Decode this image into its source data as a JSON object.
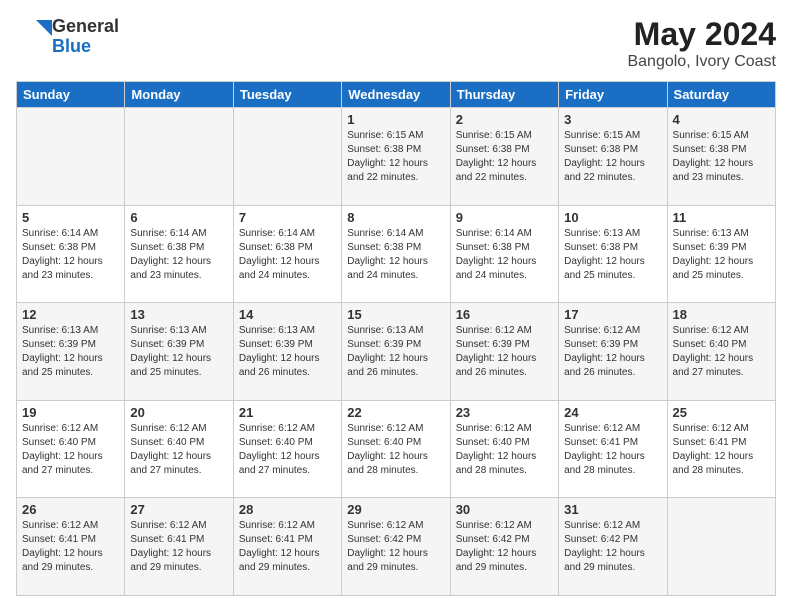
{
  "logo": {
    "line1": "General",
    "line2": "Blue"
  },
  "header": {
    "month_year": "May 2024",
    "location": "Bangolo, Ivory Coast"
  },
  "weekdays": [
    "Sunday",
    "Monday",
    "Tuesday",
    "Wednesday",
    "Thursday",
    "Friday",
    "Saturday"
  ],
  "weeks": [
    [
      {
        "day": "",
        "info": ""
      },
      {
        "day": "",
        "info": ""
      },
      {
        "day": "",
        "info": ""
      },
      {
        "day": "1",
        "info": "Sunrise: 6:15 AM\nSunset: 6:38 PM\nDaylight: 12 hours\nand 22 minutes."
      },
      {
        "day": "2",
        "info": "Sunrise: 6:15 AM\nSunset: 6:38 PM\nDaylight: 12 hours\nand 22 minutes."
      },
      {
        "day": "3",
        "info": "Sunrise: 6:15 AM\nSunset: 6:38 PM\nDaylight: 12 hours\nand 22 minutes."
      },
      {
        "day": "4",
        "info": "Sunrise: 6:15 AM\nSunset: 6:38 PM\nDaylight: 12 hours\nand 23 minutes."
      }
    ],
    [
      {
        "day": "5",
        "info": "Sunrise: 6:14 AM\nSunset: 6:38 PM\nDaylight: 12 hours\nand 23 minutes."
      },
      {
        "day": "6",
        "info": "Sunrise: 6:14 AM\nSunset: 6:38 PM\nDaylight: 12 hours\nand 23 minutes."
      },
      {
        "day": "7",
        "info": "Sunrise: 6:14 AM\nSunset: 6:38 PM\nDaylight: 12 hours\nand 24 minutes."
      },
      {
        "day": "8",
        "info": "Sunrise: 6:14 AM\nSunset: 6:38 PM\nDaylight: 12 hours\nand 24 minutes."
      },
      {
        "day": "9",
        "info": "Sunrise: 6:14 AM\nSunset: 6:38 PM\nDaylight: 12 hours\nand 24 minutes."
      },
      {
        "day": "10",
        "info": "Sunrise: 6:13 AM\nSunset: 6:38 PM\nDaylight: 12 hours\nand 25 minutes."
      },
      {
        "day": "11",
        "info": "Sunrise: 6:13 AM\nSunset: 6:39 PM\nDaylight: 12 hours\nand 25 minutes."
      }
    ],
    [
      {
        "day": "12",
        "info": "Sunrise: 6:13 AM\nSunset: 6:39 PM\nDaylight: 12 hours\nand 25 minutes."
      },
      {
        "day": "13",
        "info": "Sunrise: 6:13 AM\nSunset: 6:39 PM\nDaylight: 12 hours\nand 25 minutes."
      },
      {
        "day": "14",
        "info": "Sunrise: 6:13 AM\nSunset: 6:39 PM\nDaylight: 12 hours\nand 26 minutes."
      },
      {
        "day": "15",
        "info": "Sunrise: 6:13 AM\nSunset: 6:39 PM\nDaylight: 12 hours\nand 26 minutes."
      },
      {
        "day": "16",
        "info": "Sunrise: 6:12 AM\nSunset: 6:39 PM\nDaylight: 12 hours\nand 26 minutes."
      },
      {
        "day": "17",
        "info": "Sunrise: 6:12 AM\nSunset: 6:39 PM\nDaylight: 12 hours\nand 26 minutes."
      },
      {
        "day": "18",
        "info": "Sunrise: 6:12 AM\nSunset: 6:40 PM\nDaylight: 12 hours\nand 27 minutes."
      }
    ],
    [
      {
        "day": "19",
        "info": "Sunrise: 6:12 AM\nSunset: 6:40 PM\nDaylight: 12 hours\nand 27 minutes."
      },
      {
        "day": "20",
        "info": "Sunrise: 6:12 AM\nSunset: 6:40 PM\nDaylight: 12 hours\nand 27 minutes."
      },
      {
        "day": "21",
        "info": "Sunrise: 6:12 AM\nSunset: 6:40 PM\nDaylight: 12 hours\nand 27 minutes."
      },
      {
        "day": "22",
        "info": "Sunrise: 6:12 AM\nSunset: 6:40 PM\nDaylight: 12 hours\nand 28 minutes."
      },
      {
        "day": "23",
        "info": "Sunrise: 6:12 AM\nSunset: 6:40 PM\nDaylight: 12 hours\nand 28 minutes."
      },
      {
        "day": "24",
        "info": "Sunrise: 6:12 AM\nSunset: 6:41 PM\nDaylight: 12 hours\nand 28 minutes."
      },
      {
        "day": "25",
        "info": "Sunrise: 6:12 AM\nSunset: 6:41 PM\nDaylight: 12 hours\nand 28 minutes."
      }
    ],
    [
      {
        "day": "26",
        "info": "Sunrise: 6:12 AM\nSunset: 6:41 PM\nDaylight: 12 hours\nand 29 minutes."
      },
      {
        "day": "27",
        "info": "Sunrise: 6:12 AM\nSunset: 6:41 PM\nDaylight: 12 hours\nand 29 minutes."
      },
      {
        "day": "28",
        "info": "Sunrise: 6:12 AM\nSunset: 6:41 PM\nDaylight: 12 hours\nand 29 minutes."
      },
      {
        "day": "29",
        "info": "Sunrise: 6:12 AM\nSunset: 6:42 PM\nDaylight: 12 hours\nand 29 minutes."
      },
      {
        "day": "30",
        "info": "Sunrise: 6:12 AM\nSunset: 6:42 PM\nDaylight: 12 hours\nand 29 minutes."
      },
      {
        "day": "31",
        "info": "Sunrise: 6:12 AM\nSunset: 6:42 PM\nDaylight: 12 hours\nand 29 minutes."
      },
      {
        "day": "",
        "info": ""
      }
    ]
  ]
}
